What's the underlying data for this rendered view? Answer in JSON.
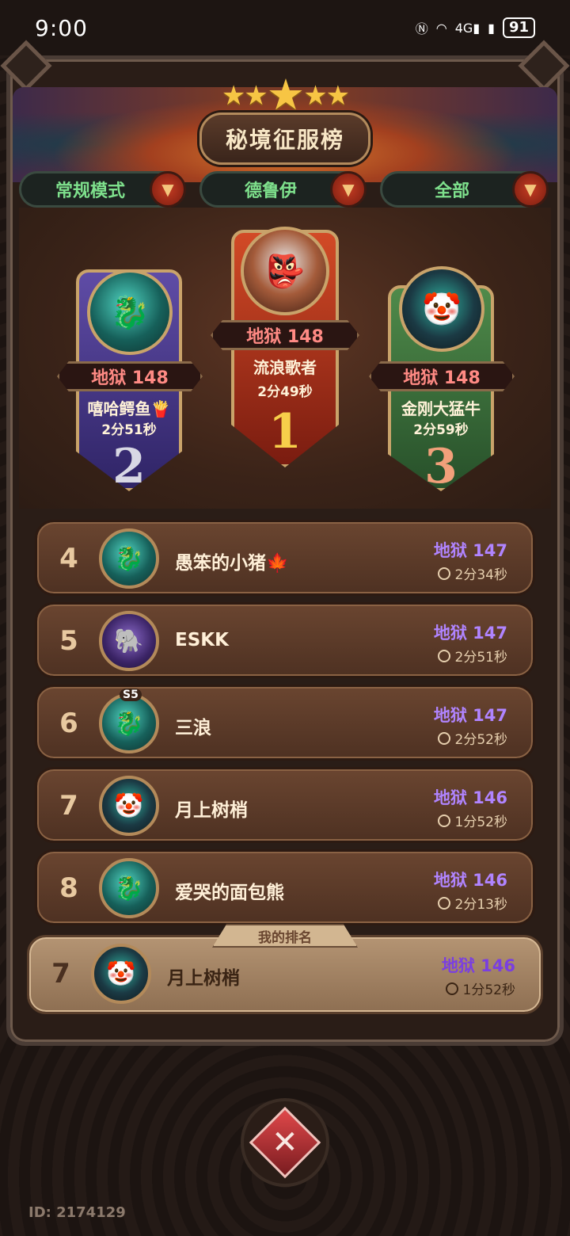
{
  "status_bar": {
    "time": "9:00",
    "icons": [
      "nfc-icon",
      "wifi-icon",
      "signal-4g-icon",
      "signal-icon"
    ],
    "network_label": "4G",
    "battery": "91"
  },
  "header": {
    "title": "秘境征服榜",
    "stars": 5
  },
  "filters": [
    {
      "label": "常规模式"
    },
    {
      "label": "德鲁伊"
    },
    {
      "label": "全部"
    }
  ],
  "podium": {
    "first": {
      "rank": "1",
      "difficulty": "地狱 148",
      "name": "流浪歌者",
      "time": "2分49秒"
    },
    "second": {
      "rank": "2",
      "difficulty": "地狱 148",
      "name": "嘻哈鳄鱼🍟",
      "time": "2分51秒"
    },
    "third": {
      "rank": "3",
      "difficulty": "地狱 148",
      "name": "金刚大猛牛",
      "time": "2分59秒"
    }
  },
  "rows": [
    {
      "rank": "4",
      "name": "愚笨的小猪🍁",
      "difficulty": "地狱 147",
      "time": "2分34秒"
    },
    {
      "rank": "5",
      "name": "ESKK",
      "difficulty": "地狱 147",
      "time": "2分51秒"
    },
    {
      "rank": "6",
      "name": "三浪",
      "difficulty": "地狱 147",
      "time": "2分52秒",
      "badge": "S5"
    },
    {
      "rank": "7",
      "name": "月上树梢",
      "difficulty": "地狱 146",
      "time": "1分52秒"
    },
    {
      "rank": "8",
      "name": "爱哭的面包熊",
      "difficulty": "地狱 146",
      "time": "2分13秒"
    }
  ],
  "my_rank": {
    "tab_label": "我的排名",
    "rank": "7",
    "name": "月上树梢",
    "difficulty": "地狱 146",
    "time": "1分52秒"
  },
  "footer": {
    "user_id": "ID: 2174129"
  },
  "colors": {
    "hell_podium": "#ff8a84",
    "hell_row": "#b084ff",
    "filter_text": "#7ee08c"
  }
}
